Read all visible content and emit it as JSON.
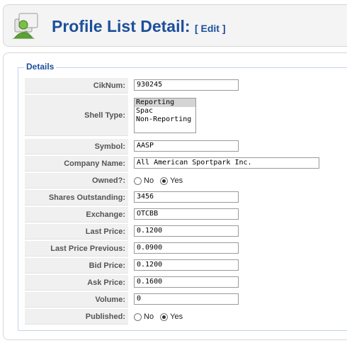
{
  "header": {
    "title": "Profile List Detail:",
    "edit_open": "[ ",
    "edit_label": "Edit",
    "edit_close": " ]"
  },
  "details": {
    "legend": "Details",
    "fields": {
      "ciknum": {
        "label": "CikNum:",
        "value": "930245"
      },
      "shell_type": {
        "label": "Shell Type:",
        "options": [
          "Reporting",
          "Spac",
          "Non-Reporting"
        ],
        "selected": "Reporting"
      },
      "symbol": {
        "label": "Symbol:",
        "value": "AASP"
      },
      "company_name": {
        "label": "Company Name:",
        "value": "All American Sportpark Inc."
      },
      "owned": {
        "label": "Owned?:",
        "no_label": "No",
        "yes_label": "Yes",
        "selected": "Yes"
      },
      "shares_outstanding": {
        "label": "Shares Outstanding:",
        "value": "3456"
      },
      "exchange": {
        "label": "Exchange:",
        "value": "OTCBB"
      },
      "last_price": {
        "label": "Last Price:",
        "value": "0.1200"
      },
      "last_price_previous": {
        "label": "Last Price Previous:",
        "value": "0.0900"
      },
      "bid_price": {
        "label": "Bid Price:",
        "value": "0.1200"
      },
      "ask_price": {
        "label": "Ask Price:",
        "value": "0.1600"
      },
      "volume": {
        "label": "Volume:",
        "value": "0"
      },
      "published": {
        "label": "Published:",
        "no_label": "No",
        "yes_label": "Yes",
        "selected": "Yes"
      }
    }
  },
  "colors": {
    "title": "#1c4f9c",
    "label_bg": "#f0f0f0"
  },
  "icons": {
    "logo": "profile-users-icon"
  }
}
